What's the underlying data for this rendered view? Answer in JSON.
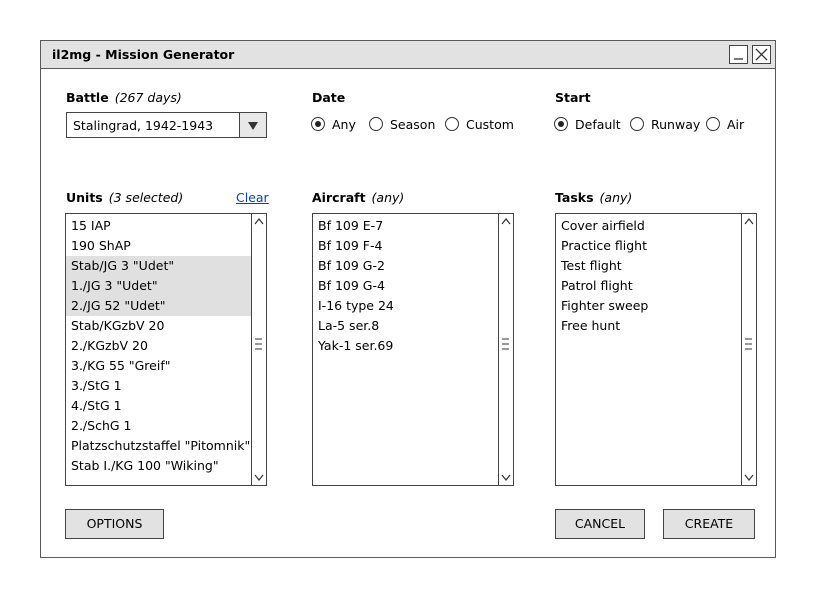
{
  "window": {
    "title": "il2mg - Mission Generator"
  },
  "battle": {
    "label": "Battle",
    "note": "(267 days)",
    "selected": "Stalingrad, 1942-1943"
  },
  "date": {
    "label": "Date",
    "options": [
      {
        "label": "Any",
        "checked": true
      },
      {
        "label": "Season",
        "checked": false
      },
      {
        "label": "Custom",
        "checked": false
      }
    ]
  },
  "start": {
    "label": "Start",
    "options": [
      {
        "label": "Default",
        "checked": true
      },
      {
        "label": "Runway",
        "checked": false
      },
      {
        "label": "Air",
        "checked": false
      }
    ]
  },
  "units": {
    "label": "Units",
    "note": "(3 selected)",
    "clear_link": "Clear",
    "items": [
      {
        "label": "15 IAP",
        "selected": false
      },
      {
        "label": "190 ShAP",
        "selected": false
      },
      {
        "label": "Stab/JG 3 \"Udet\"",
        "selected": true
      },
      {
        "label": "1./JG 3 \"Udet\"",
        "selected": true
      },
      {
        "label": "2./JG 52 \"Udet\"",
        "selected": true
      },
      {
        "label": "Stab/KGzbV 20",
        "selected": false
      },
      {
        "label": "2./KGzbV 20",
        "selected": false
      },
      {
        "label": "3./KG 55 \"Greif\"",
        "selected": false
      },
      {
        "label": "3./StG 1",
        "selected": false
      },
      {
        "label": "4./StG 1",
        "selected": false
      },
      {
        "label": "2./SchG 1",
        "selected": false
      },
      {
        "label": "Platzschutzstaffel \"Pitomnik\"",
        "selected": false
      },
      {
        "label": "Stab I./KG 100 \"Wiking\"",
        "selected": false
      }
    ]
  },
  "aircraft": {
    "label": "Aircraft",
    "note": "(any)",
    "items": [
      "Bf 109 E-7",
      "Bf 109 F-4",
      "Bf 109 G-2",
      "Bf 109 G-4",
      "I-16 type 24",
      "La-5 ser.8",
      "Yak-1 ser.69"
    ]
  },
  "tasks": {
    "label": "Tasks",
    "note": "(any)",
    "items": [
      "Cover airfield",
      "Practice flight",
      "Test flight",
      "Patrol flight",
      "Fighter sweep",
      "Free hunt"
    ]
  },
  "buttons": {
    "options": "OPTIONS",
    "cancel": "CANCEL",
    "create": "CREATE"
  },
  "icons": {
    "minimize": "minimize-icon",
    "close": "close-icon",
    "dropdown": "chevron-down-icon",
    "scroll_up": "scroll-up-icon",
    "scroll_down": "scroll-down-icon"
  }
}
